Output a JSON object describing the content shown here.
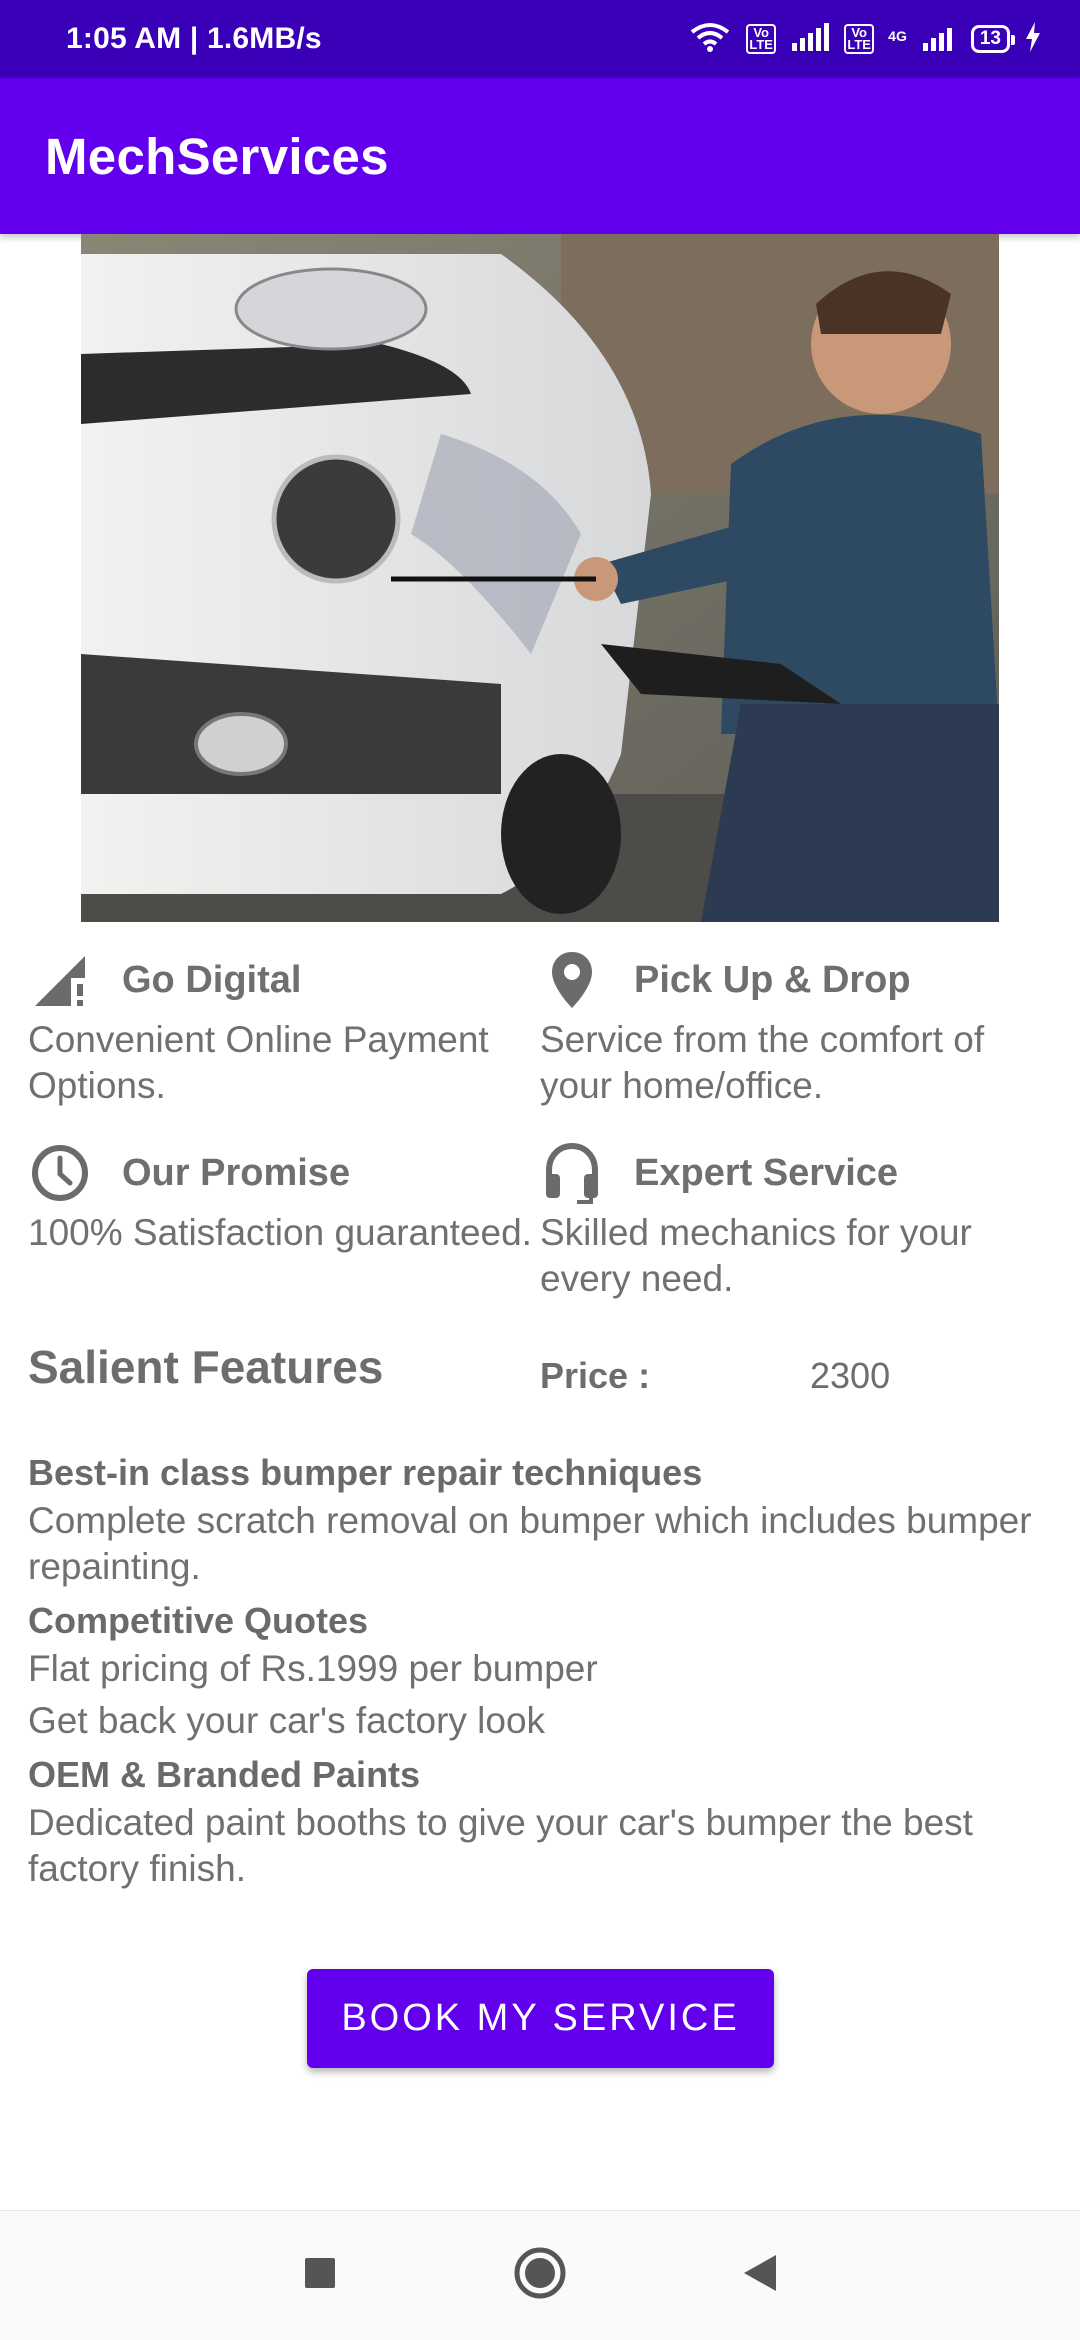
{
  "status": {
    "time": "1:05 AM | 1.6MB/s",
    "volte1": "Vo LTE",
    "volte2": "Vo LTE",
    "network": "4G",
    "battery": "13"
  },
  "app": {
    "title": "MechServices"
  },
  "hero": {
    "icon": "car-repair-photo"
  },
  "features": [
    {
      "icon": "signal-icon",
      "title": "Go Digital",
      "desc": "Convenient Online Payment Options."
    },
    {
      "icon": "location-pin-icon",
      "title": "Pick Up & Drop",
      "desc": "Service from the comfort of your home/office."
    },
    {
      "icon": "clock-icon",
      "title": "Our Promise",
      "desc": "100% Satisfaction guaranteed."
    },
    {
      "icon": "headset-icon",
      "title": "Expert Service",
      "desc": "Skilled mechanics for your every need."
    }
  ],
  "salient": {
    "title": "Salient Features"
  },
  "price": {
    "label": "Price :",
    "value": "2300"
  },
  "details": [
    {
      "heading": "Best-in class bumper repair techniques",
      "lines": [
        "Complete scratch removal on bumper which includes bumper repainting."
      ]
    },
    {
      "heading": "Competitive Quotes",
      "lines": [
        "Flat pricing of Rs.1999 per bumper",
        "Get back your car's factory look"
      ]
    },
    {
      "heading": "OEM & Branded Paints",
      "lines": [
        "Dedicated paint booths to give your car's bumper the best factory finish."
      ]
    }
  ],
  "cta": {
    "label": "BOOK MY SERVICE"
  },
  "colors": {
    "primary": "#6200ee",
    "status": "#3a00b8",
    "text": "#707070"
  }
}
